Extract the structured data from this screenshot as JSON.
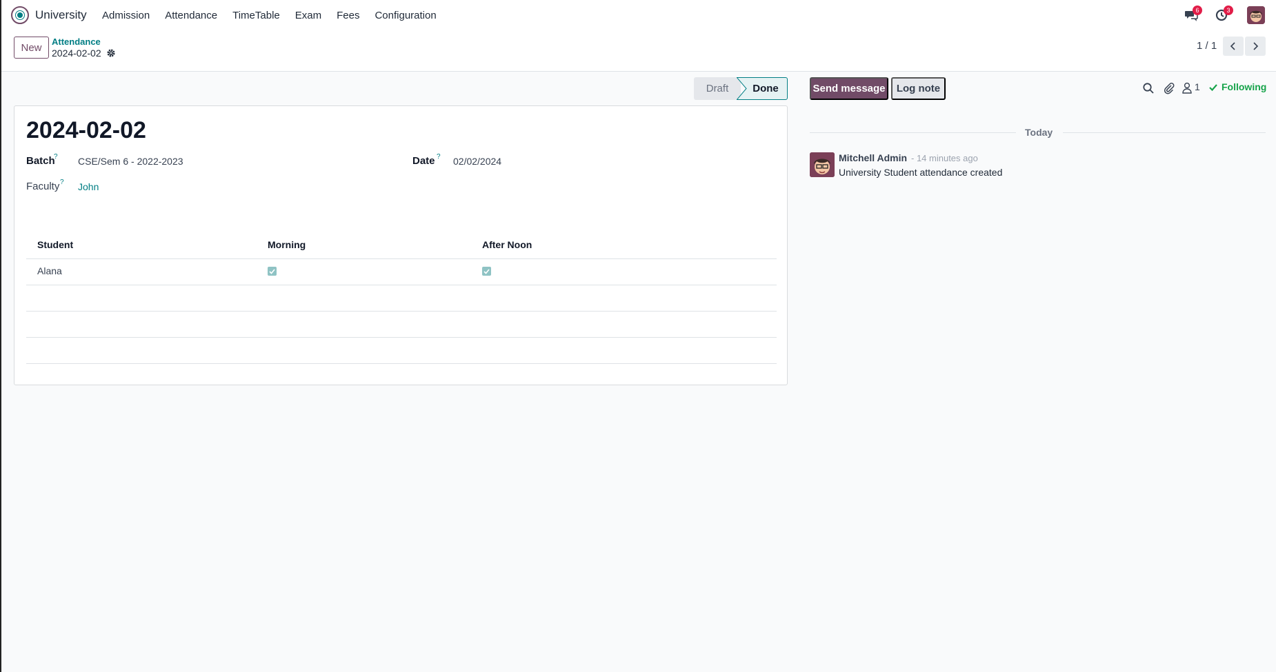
{
  "navbar": {
    "app_name": "University",
    "menu": [
      "Admission",
      "Attendance",
      "TimeTable",
      "Exam",
      "Fees",
      "Configuration"
    ],
    "messages_badge": "6",
    "activities_badge": "3"
  },
  "control": {
    "new_label": "New",
    "breadcrumb_parent": "Attendance",
    "breadcrumb_current": "2024-02-02",
    "pager": "1 / 1"
  },
  "status": {
    "stages": [
      "Draft",
      "Done"
    ],
    "active": "Done"
  },
  "form": {
    "title": "2024-02-02",
    "batch_label": "Batch",
    "batch_value": "CSE/Sem 6 - 2022-2023",
    "date_label": "Date",
    "date_value": "02/02/2024",
    "faculty_label": "Faculty",
    "faculty_value": "John",
    "help_mark": "?",
    "table": {
      "headers": [
        "Student",
        "Morning",
        "After Noon"
      ],
      "rows": [
        {
          "student": "Alana",
          "morning": true,
          "afternoon": true
        }
      ]
    }
  },
  "chatter": {
    "send_label": "Send message",
    "log_label": "Log note",
    "followers_count": "1",
    "following_label": "Following",
    "date_separator": "Today",
    "messages": [
      {
        "author": "Mitchell Admin",
        "time": "- 14 minutes ago",
        "body": "University Student attendance created"
      }
    ]
  },
  "colors": {
    "brand": "#714b67",
    "accent": "#017e84",
    "following": "#16a34a",
    "badge": "#e11d48"
  }
}
